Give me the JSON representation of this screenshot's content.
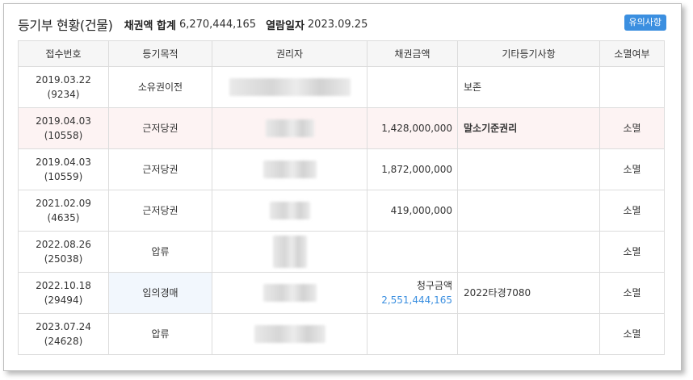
{
  "header": {
    "title": "등기부 현황(건물)",
    "total_label": "채권액 합계",
    "total_value": "6,270,444,165",
    "date_label": "열람일자",
    "date_value": "2023.09.25",
    "notice_button": "유의사항"
  },
  "table": {
    "columns": [
      "접수번호",
      "등기목적",
      "권리자",
      "채권금액",
      "기타등기사항",
      "소멸여부"
    ],
    "rows": [
      {
        "date": "2019.03.22",
        "num": "(9234)",
        "purpose": "소유권이전",
        "holder": "",
        "amount": "",
        "etc": "보존",
        "status": ""
      },
      {
        "date": "2019.04.03",
        "num": "(10558)",
        "purpose": "근저당권",
        "holder": "",
        "amount": "1,428,000,000",
        "etc": "말소기준권리",
        "status": "소멸"
      },
      {
        "date": "2019.04.03",
        "num": "(10559)",
        "purpose": "근저당권",
        "holder": "",
        "amount": "1,872,000,000",
        "etc": "",
        "status": "소멸"
      },
      {
        "date": "2021.02.09",
        "num": "(4635)",
        "purpose": "근저당권",
        "holder": "",
        "amount": "419,000,000",
        "etc": "",
        "status": "소멸"
      },
      {
        "date": "2022.08.26",
        "num": "(25038)",
        "purpose": "압류",
        "holder": "",
        "amount": "",
        "etc": "",
        "status": "소멸"
      },
      {
        "date": "2022.10.18",
        "num": "(29494)",
        "purpose": "임의경매",
        "holder": "",
        "amount_label": "청구금액",
        "amount": "2,551,444,165",
        "etc": "2022타경7080",
        "status": "소멸"
      },
      {
        "date": "2023.07.24",
        "num": "(24628)",
        "purpose": "압류",
        "holder": "",
        "amount": "",
        "etc": "",
        "status": "소멸"
      }
    ]
  }
}
